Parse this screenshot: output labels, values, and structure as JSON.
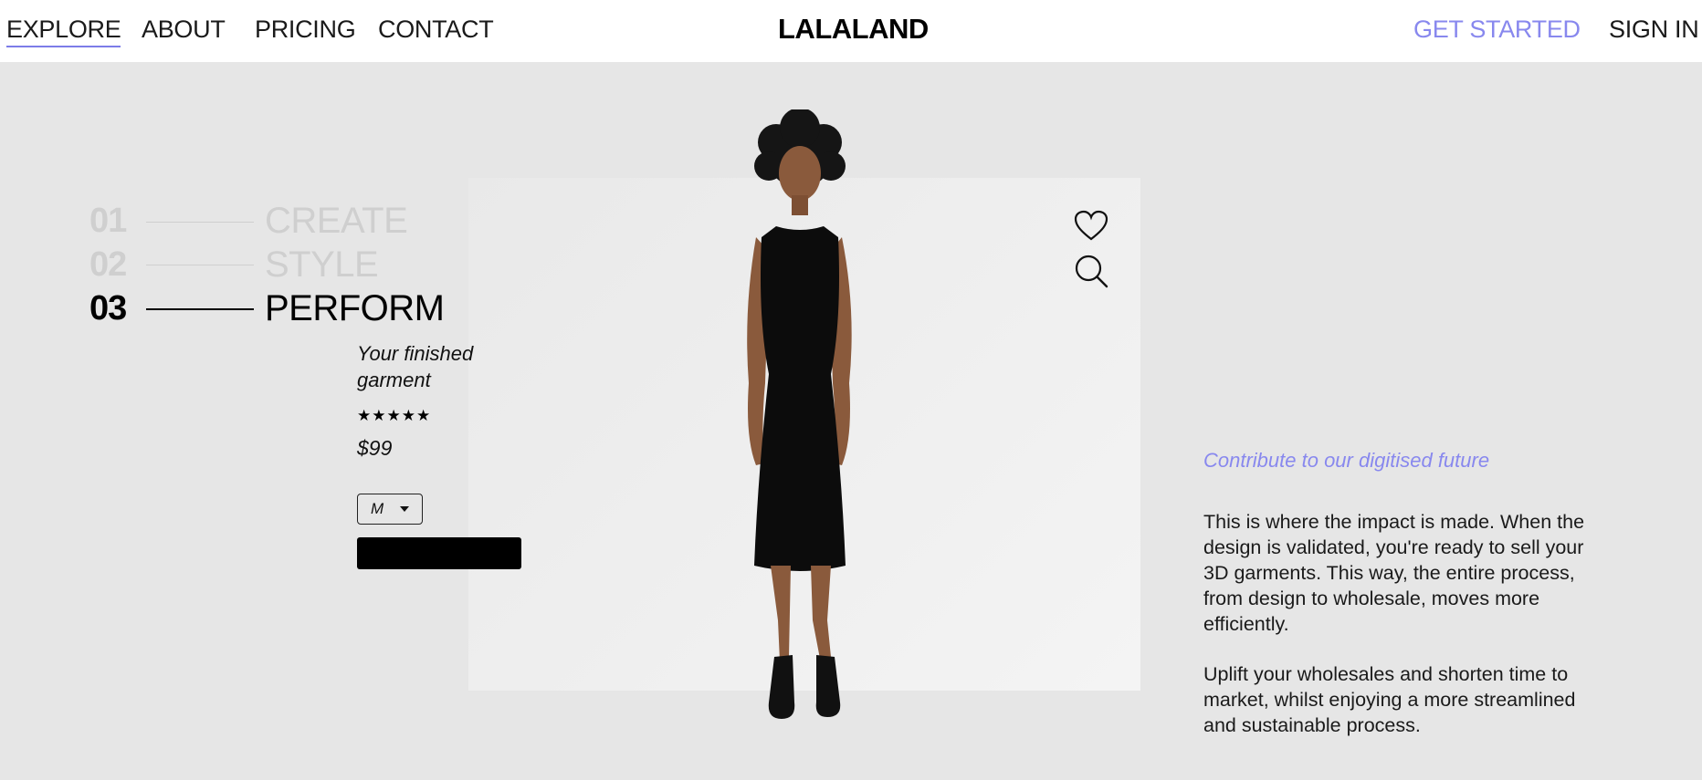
{
  "nav": {
    "left": [
      {
        "label": "EXPLORE",
        "active": true
      },
      {
        "label": "ABOUT"
      },
      {
        "label": "PRICING"
      },
      {
        "label": "CONTACT"
      }
    ],
    "brand": "LALALAND",
    "get_started": "GET STARTED",
    "sign_in": "SIGN IN"
  },
  "steps": [
    {
      "num": "01",
      "label": "CREATE",
      "active": false
    },
    {
      "num": "02",
      "label": "STYLE",
      "active": false
    },
    {
      "num": "03",
      "label": "PERFORM",
      "active": true
    }
  ],
  "product": {
    "name": "Your finished garment",
    "rating_stars": "★★★★★",
    "rating": 5,
    "price": "$99",
    "size": "M"
  },
  "icons": {
    "favorite": "heart-icon",
    "search": "search-icon",
    "select_caret": "caret-down-icon"
  },
  "content": {
    "tagline": "Contribute to our digitised future",
    "paragraph1": "This is where the impact is made. When the design is validated, you're ready to sell your 3D garments. This way, the entire process, from design to wholesale, moves more efficiently.",
    "paragraph2": "Uplift your wholesales and shorten time to market, whilst enjoying a more streamlined and sustainable process."
  },
  "colors": {
    "accent": "#8888ee",
    "background": "#e6e6e6",
    "inactive_step": "#cfcfcf"
  }
}
